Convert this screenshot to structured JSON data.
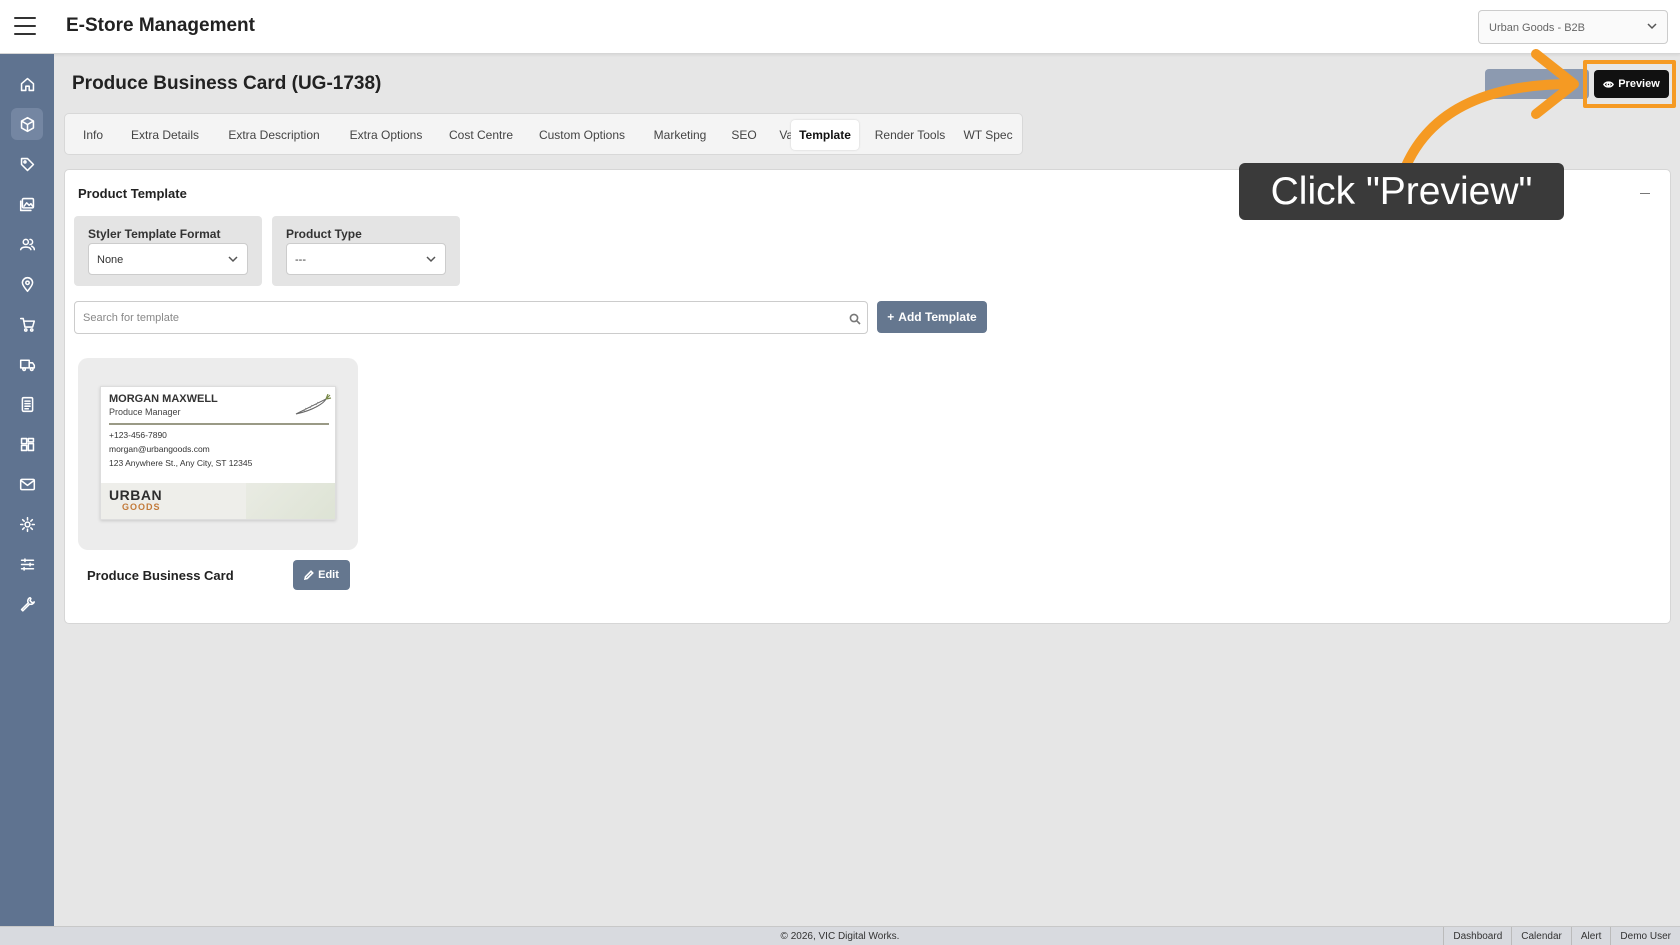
{
  "app": {
    "title": "E-Store Management",
    "store_selector": "Urban Goods - B2B"
  },
  "page": {
    "title": "Produce Business Card (UG-1738)",
    "preview_label": "Preview"
  },
  "tabs": [
    {
      "label": "Info"
    },
    {
      "label": "Extra Details"
    },
    {
      "label": "Extra Description"
    },
    {
      "label": "Extra Options"
    },
    {
      "label": "Cost Centre"
    },
    {
      "label": "Custom Options"
    },
    {
      "label": "Marketing"
    },
    {
      "label": "SEO"
    },
    {
      "label": "Variants"
    },
    {
      "label": "Template",
      "active": true
    },
    {
      "label": "Render Tools"
    },
    {
      "label": "WT Spec"
    }
  ],
  "sidebar": {
    "icons": [
      "home-icon",
      "box-icon",
      "tag-icon",
      "images-icon",
      "users-icon",
      "location-pin-icon",
      "cart-icon",
      "truck-icon",
      "document-icon",
      "grid-icon",
      "mail-icon",
      "gear-icon",
      "sliders-icon",
      "wrench-icon"
    ],
    "active_index": 1
  },
  "panel": {
    "title": "Product Template",
    "styler": {
      "label": "Styler Template Format",
      "value": "None"
    },
    "product_type": {
      "label": "Product Type",
      "value": "---"
    },
    "search_placeholder": "Search for template",
    "add_button": "Add Template"
  },
  "template": {
    "name": "Produce Business Card",
    "edit_label": "Edit",
    "card": {
      "name": "MORGAN MAXWELL",
      "role": "Produce Manager",
      "phone": "+123-456-7890",
      "email": "morgan@urbangoods.com",
      "address": "123 Anywhere St., Any City, ST 12345",
      "logo_line1": "URBAN",
      "logo_line2": "GOODS"
    }
  },
  "annotation": {
    "text": "Click \"Preview\"",
    "color": "#f59a23"
  },
  "footer": {
    "copyright": "© 2026, VIC Digital Works.",
    "links": [
      "Dashboard",
      "Calendar",
      "Alert",
      "Demo User"
    ]
  }
}
